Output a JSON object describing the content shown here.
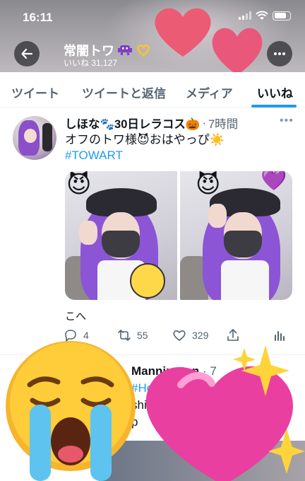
{
  "status": {
    "time": "16:11"
  },
  "header": {
    "title": "常闇トワ",
    "likes_line": "いいね 31,127"
  },
  "tabs": [
    {
      "label": "ツイート",
      "active": false
    },
    {
      "label": "ツイートと返信",
      "active": false
    },
    {
      "label": "メディア",
      "active": false
    },
    {
      "label": "いいね",
      "active": true
    }
  ],
  "tweet": {
    "author": "しほな🐾30日レラコス🎃",
    "time": "7時間",
    "text": "オフのトワ様😈おはやっぴ☀️",
    "hashtag": "#TOWART",
    "caption": "こへ",
    "replies": "4",
    "retweets": "55",
    "likes": "329"
  },
  "tweet2": {
    "author": "Mannington",
    "meta": "· 7",
    "line1": "#Holoctob",
    "line2": "shi",
    "line3": "p"
  },
  "colors": {
    "accent": "#1d9bf0",
    "text": "#0f1419",
    "muted": "#536471"
  }
}
